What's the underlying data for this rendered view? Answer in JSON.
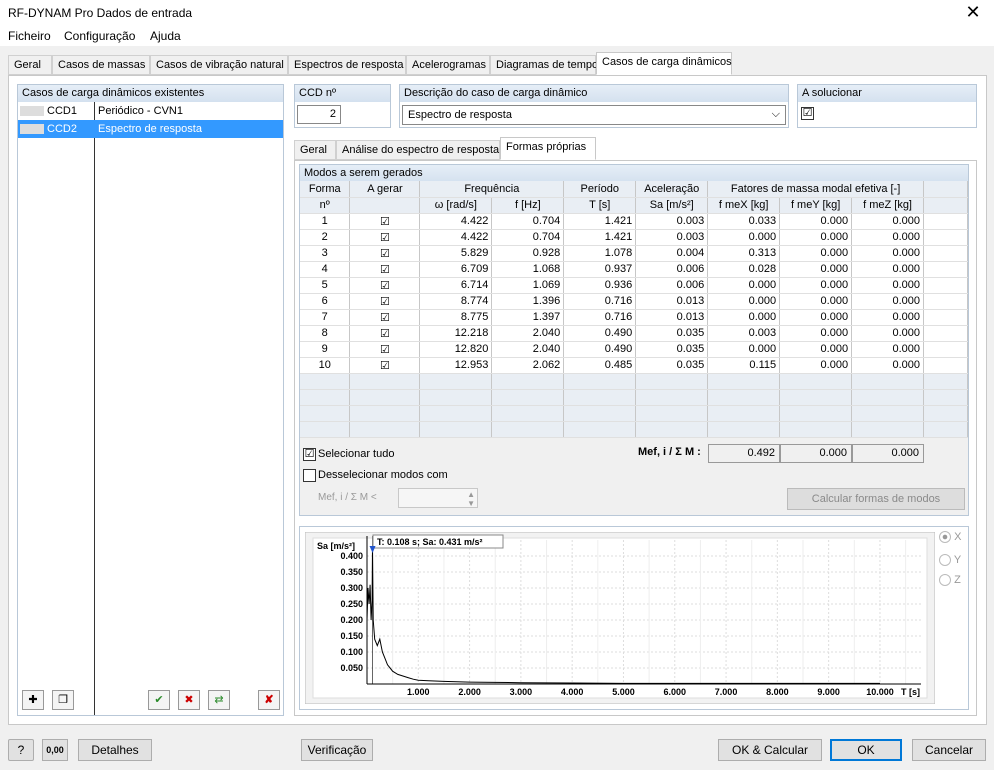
{
  "window": {
    "title": "RF-DYNAM Pro Dados de entrada",
    "close": "✕"
  },
  "menu": [
    "Ficheiro",
    "Configuração",
    "Ajuda"
  ],
  "tabs": [
    "Geral",
    "Casos de massas",
    "Casos de vibração natural",
    "Espectros de resposta",
    "Acelerogramas",
    "Diagramas de tempo",
    "Casos de carga dinâmicos"
  ],
  "left": {
    "header": "Casos de carga dinâmicos existentes",
    "items": [
      {
        "code": "CCD1",
        "name": "Periódico - CVN1"
      },
      {
        "code": "CCD2",
        "name": "Espectro de resposta"
      }
    ]
  },
  "ccd": {
    "label": "CCD nº",
    "value": "2"
  },
  "desc": {
    "label": "Descrição do caso de carga dinâmico",
    "value": "Espectro de resposta"
  },
  "solve": {
    "label": "A solucionar",
    "checked": "☑"
  },
  "subtabs": [
    "Geral",
    "Análise do espectro de resposta",
    "Formas próprias"
  ],
  "modes": {
    "header": "Modos a serem gerados",
    "cols": {
      "forma": "Forma",
      "nr": "nº",
      "gerar": "A gerar",
      "freq": "Frequência",
      "omega": "ω [rad/s]",
      "f": "f [Hz]",
      "periodo": "Período",
      "T": "T [s]",
      "acel": "Aceleração",
      "Sa": "Sa [m/s²]",
      "fatores": "Fatores de massa modal efetiva [-]",
      "fx": "f meX [kg]",
      "fy": "f meY [kg]",
      "fz": "f meZ [kg]"
    },
    "rows": [
      [
        "1",
        "☑",
        "4.422",
        "0.704",
        "1.421",
        "0.003",
        "0.033",
        "0.000",
        "0.000"
      ],
      [
        "2",
        "☑",
        "4.422",
        "0.704",
        "1.421",
        "0.003",
        "0.000",
        "0.000",
        "0.000"
      ],
      [
        "3",
        "☑",
        "5.829",
        "0.928",
        "1.078",
        "0.004",
        "0.313",
        "0.000",
        "0.000"
      ],
      [
        "4",
        "☑",
        "6.709",
        "1.068",
        "0.937",
        "0.006",
        "0.028",
        "0.000",
        "0.000"
      ],
      [
        "5",
        "☑",
        "6.714",
        "1.069",
        "0.936",
        "0.006",
        "0.000",
        "0.000",
        "0.000"
      ],
      [
        "6",
        "☑",
        "8.774",
        "1.396",
        "0.716",
        "0.013",
        "0.000",
        "0.000",
        "0.000"
      ],
      [
        "7",
        "☑",
        "8.775",
        "1.397",
        "0.716",
        "0.013",
        "0.000",
        "0.000",
        "0.000"
      ],
      [
        "8",
        "☑",
        "12.218",
        "2.040",
        "0.490",
        "0.035",
        "0.003",
        "0.000",
        "0.000"
      ],
      [
        "9",
        "☑",
        "12.820",
        "2.040",
        "0.490",
        "0.035",
        "0.000",
        "0.000",
        "0.000"
      ],
      [
        "10",
        "☑",
        "12.953",
        "2.062",
        "0.485",
        "0.035",
        "0.115",
        "0.000",
        "0.000"
      ]
    ],
    "select_all": "Selecionar tudo",
    "deselect": "Desselecionar modos com",
    "mef_label": "Mef, i / Σ M :",
    "mef_small": "Mef, i / Σ M  <",
    "sums": [
      "0.492",
      "0.000",
      "0.000"
    ],
    "calc": "Calcular formas de modos"
  },
  "chart_data": {
    "type": "line",
    "ylabel": "Sa [m/s²]",
    "xlabel": "T [s]",
    "tooltip": "T: 0.108 s; Sa: 0.431 m/s²",
    "yticks": [
      "0.400",
      "0.350",
      "0.300",
      "0.250",
      "0.200",
      "0.150",
      "0.100",
      "0.050"
    ],
    "xticks": [
      "1.000",
      "2.000",
      "3.000",
      "4.000",
      "5.000",
      "6.000",
      "7.000",
      "8.000",
      "9.000",
      "10.000"
    ],
    "xlim": [
      0,
      10.8
    ],
    "ylim": [
      0,
      0.45
    ],
    "x": [
      0.0,
      0.02,
      0.04,
      0.06,
      0.08,
      0.1,
      0.108,
      0.12,
      0.15,
      0.2,
      0.25,
      0.3,
      0.35,
      0.4,
      0.45,
      0.5,
      0.6,
      0.7,
      0.8,
      0.9,
      1.0,
      1.2,
      1.5,
      2.0,
      2.5,
      3.0,
      4.0,
      5.0,
      6.0,
      7.0,
      8.0,
      9.0,
      10.0
    ],
    "y": [
      0.2,
      0.3,
      0.25,
      0.31,
      0.2,
      0.26,
      0.431,
      0.2,
      0.14,
      0.12,
      0.14,
      0.1,
      0.08,
      0.06,
      0.05,
      0.04,
      0.03,
      0.025,
      0.02,
      0.015,
      0.012,
      0.01,
      0.008,
      0.006,
      0.005,
      0.004,
      0.003,
      0.002,
      0.002,
      0.002,
      0.002,
      0.002,
      0.002
    ]
  },
  "radios": [
    "X",
    "Y",
    "Z"
  ],
  "bottom": {
    "detalhes": "Detalhes",
    "verificacao": "Verificação",
    "okcalc": "OK & Calcular",
    "ok": "OK",
    "cancel": "Cancelar",
    "zero": "0,00"
  }
}
